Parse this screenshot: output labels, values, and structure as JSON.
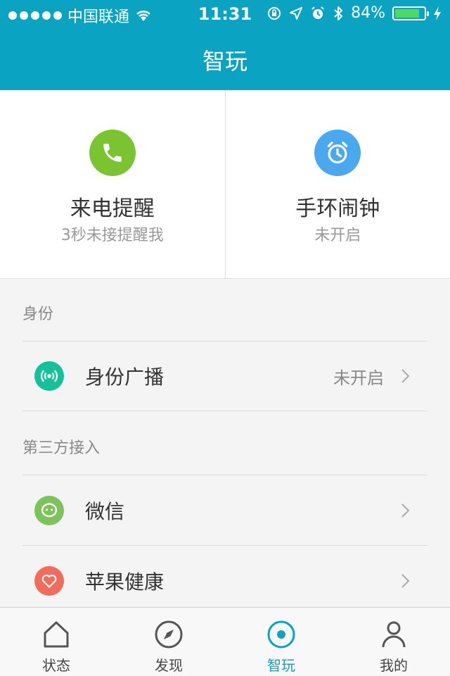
{
  "status_bar": {
    "carrier": "中国联通",
    "time": "11:31",
    "battery_percent": "84%",
    "battery_level": 0.84
  },
  "header": {
    "title": "智玩"
  },
  "cards": [
    {
      "title": "来电提醒",
      "subtitle": "3秒未接提醒我",
      "icon": "phone-icon",
      "color": "#7ac331"
    },
    {
      "title": "手环闹钟",
      "subtitle": "未开启",
      "icon": "alarm-clock-icon",
      "color": "#4aa8ef"
    }
  ],
  "identity_section": {
    "header": "身份",
    "items": [
      {
        "label": "身份广播",
        "value": "未开启",
        "icon": "broadcast-icon",
        "color": "#14c29a"
      }
    ]
  },
  "third_party_section": {
    "header": "第三方接入",
    "items": [
      {
        "label": "微信",
        "icon": "wechat-icon",
        "color": "#7cc35c"
      },
      {
        "label": "苹果健康",
        "icon": "heart-icon",
        "color": "#f26b5b"
      }
    ]
  },
  "tabbar": {
    "tabs": [
      {
        "label": "状态",
        "icon": "home-icon"
      },
      {
        "label": "发现",
        "icon": "compass-icon"
      },
      {
        "label": "智玩",
        "icon": "target-icon",
        "active": true
      },
      {
        "label": "我的",
        "icon": "person-icon"
      }
    ]
  },
  "accent_color": "#0aa3c2"
}
